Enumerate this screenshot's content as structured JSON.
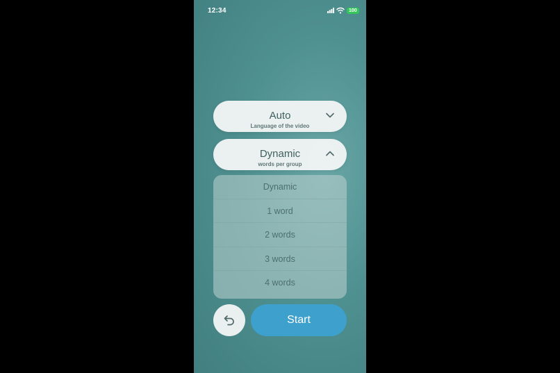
{
  "status_bar": {
    "time": "12:34",
    "battery": "100",
    "icons": [
      "signal-icon",
      "wifi-icon",
      "battery-icon"
    ]
  },
  "language_select": {
    "value": "Auto",
    "subtitle": "Language of the video",
    "icon": "chevron-down-icon"
  },
  "words_select": {
    "value": "Dynamic",
    "subtitle": "words per group",
    "icon": "chevron-up-icon"
  },
  "words_options": [
    "Dynamic",
    "1 word",
    "2 words",
    "3 words",
    "4 words"
  ],
  "actions": {
    "back_icon": "undo-arrow-icon",
    "start_label": "Start"
  },
  "colors": {
    "background": "#4f9090",
    "accent": "#3ea0cc",
    "battery": "#33c759"
  }
}
